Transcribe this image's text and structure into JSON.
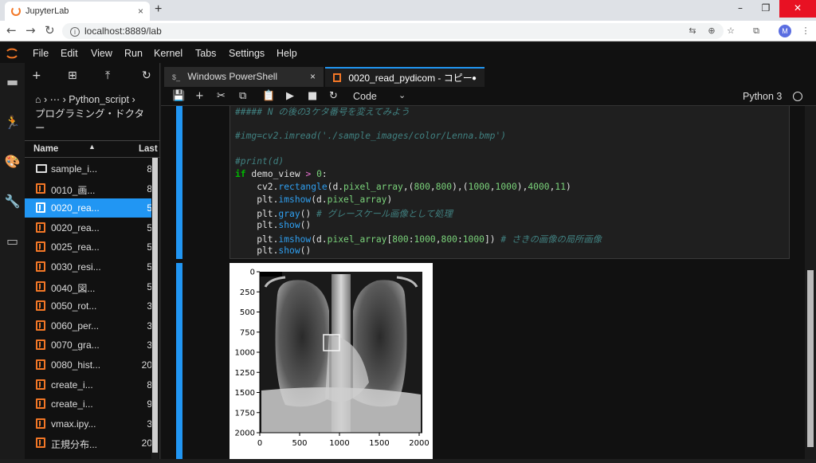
{
  "browser": {
    "tab_title": "JupyterLab",
    "tab_close": "×",
    "new_tab": "+",
    "url": "localhost:8889/lab",
    "avatar_letter": "M",
    "win_min": "–",
    "win_restore": "❐",
    "win_close": "✕"
  },
  "menu": [
    "File",
    "Edit",
    "View",
    "Run",
    "Kernel",
    "Tabs",
    "Settings",
    "Help"
  ],
  "filebrowser": {
    "breadcrumb_line1": "⌂ › ⋯ › Python_script ›",
    "breadcrumb_line2": "プログラミング・ドクタ",
    "breadcrumb_line3": "ー",
    "col_name": "Name",
    "col_last": "Last",
    "rows": [
      {
        "name": "sample_i...",
        "date": "8",
        "type": "folder"
      },
      {
        "name": "0010_画...",
        "date": "8",
        "type": "notebook"
      },
      {
        "name": "0020_rea...",
        "date": "5",
        "type": "notebook",
        "selected": true
      },
      {
        "name": "0020_rea...",
        "date": "5",
        "type": "notebook"
      },
      {
        "name": "0025_rea...",
        "date": "5",
        "type": "notebook"
      },
      {
        "name": "0030_resi...",
        "date": "5",
        "type": "notebook"
      },
      {
        "name": "0040_図...",
        "date": "5",
        "type": "notebook"
      },
      {
        "name": "0050_rot...",
        "date": "3",
        "type": "notebook"
      },
      {
        "name": "0060_per...",
        "date": "3",
        "type": "notebook"
      },
      {
        "name": "0070_gra...",
        "date": "3",
        "type": "notebook"
      },
      {
        "name": "0080_hist...",
        "date": "20",
        "type": "notebook"
      },
      {
        "name": "create_i...",
        "date": "8",
        "type": "notebook"
      },
      {
        "name": "create_i...",
        "date": "9",
        "type": "notebook"
      },
      {
        "name": "vmax.ipy...",
        "date": "3",
        "type": "notebook"
      },
      {
        "name": "正規分布...",
        "date": "20",
        "type": "notebook"
      }
    ]
  },
  "tabs": {
    "powershell": "Windows PowerShell",
    "notebook": "0020_read_pydicom - コピー",
    "close": "×",
    "modified_dot": "●"
  },
  "toolbar": {
    "cell_type": "Code",
    "kernel": "Python 3"
  },
  "code_lines": [
    "##### N の後の3ケタ番号を変えてみよう",
    "",
    "#img=cv2.imread('./sample_images/color/Lenna.bmp')",
    "",
    "#print(d)",
    "if demo_view > 0:",
    "    cv2.rectangle(d.pixel_array,(800,800),(1000,1000),4000,11)",
    "    plt.imshow(d.pixel_array)",
    "    plt.gray() # グレースケール画像として処理",
    "    plt.show()",
    "    plt.imshow(d.pixel_array[800:1000,800:1000]) # さきの画像の局所画像",
    "    plt.show()"
  ],
  "output_plot": {
    "y_ticks": [
      "0",
      "250",
      "500",
      "750",
      "1000",
      "1250",
      "1500",
      "1750",
      "2000"
    ],
    "x_ticks": [
      "0",
      "500",
      "1000",
      "1500",
      "2000"
    ]
  }
}
